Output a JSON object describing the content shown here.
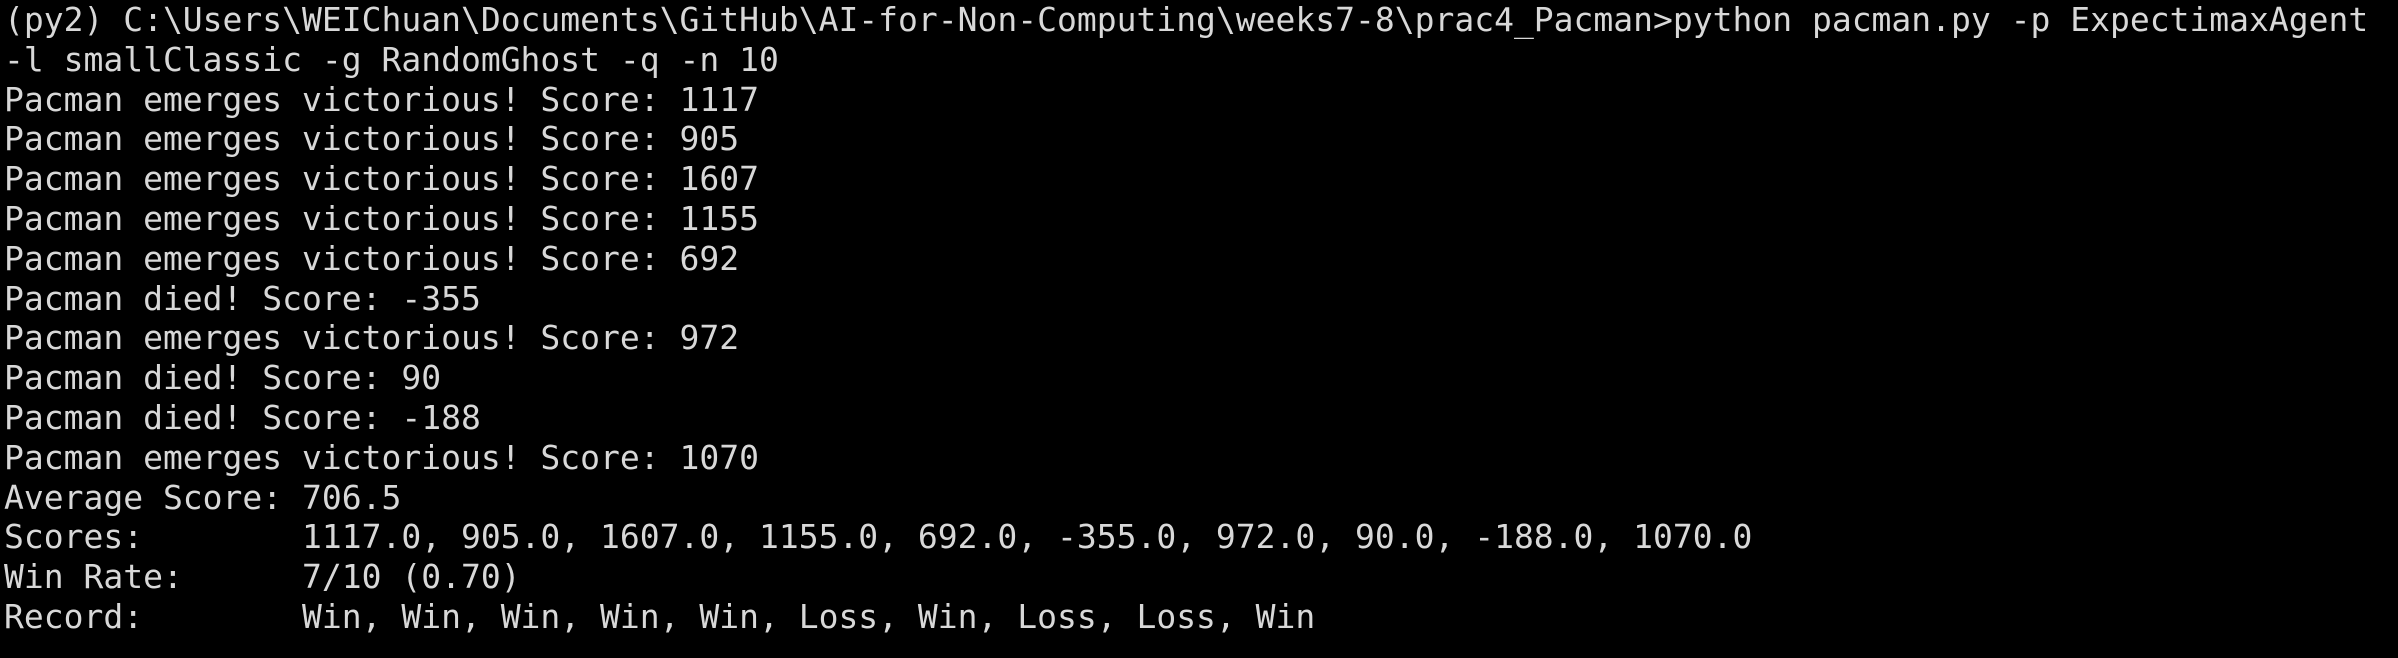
{
  "console": {
    "prompt_line": "(py2) C:\\Users\\WEIChuan\\Documents\\GitHub\\AI-for-Non-Computing\\weeks7-8\\prac4_Pacman>python pacman.py -p ExpectimaxAgent",
    "prompt_line_cont": "-l smallClassic -g RandomGhost -q -n 10",
    "results": [
      "Pacman emerges victorious! Score: 1117",
      "Pacman emerges victorious! Score: 905",
      "Pacman emerges victorious! Score: 1607",
      "Pacman emerges victorious! Score: 1155",
      "Pacman emerges victorious! Score: 692",
      "Pacman died! Score: -355",
      "Pacman emerges victorious! Score: 972",
      "Pacman died! Score: 90",
      "Pacman died! Score: -188",
      "Pacman emerges victorious! Score: 1070"
    ],
    "average_line": "Average Score: 706.5",
    "scores_line": "Scores:        1117.0, 905.0, 1607.0, 1155.0, 692.0, -355.0, 972.0, 90.0, -188.0, 1070.0",
    "winrate_line": "Win Rate:      7/10 (0.70)",
    "record_line": "Record:        Win, Win, Win, Win, Win, Loss, Win, Loss, Loss, Win"
  },
  "colors": {
    "background": "#000000",
    "text": "#d8d8d8"
  }
}
